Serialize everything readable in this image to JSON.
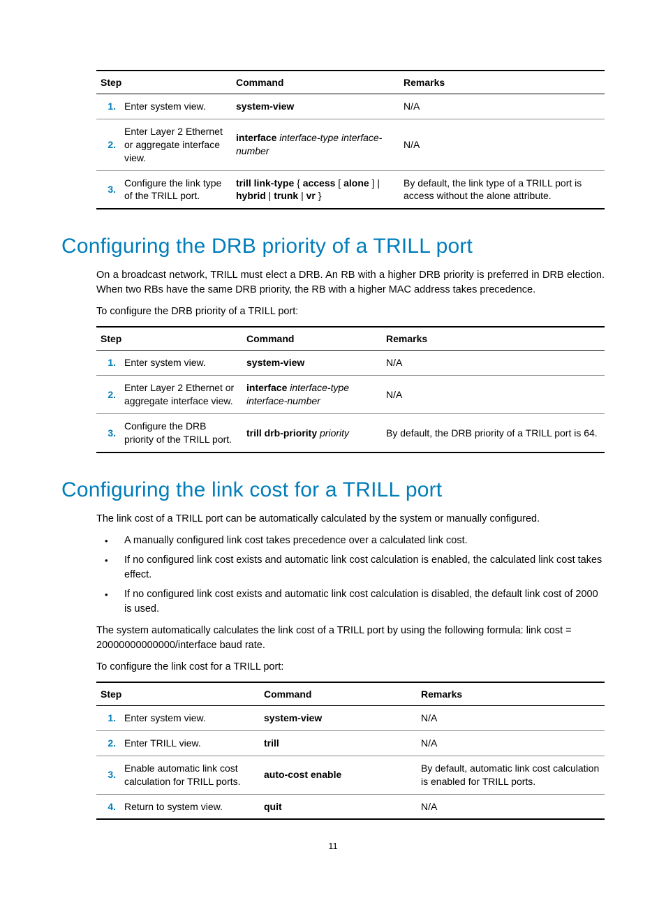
{
  "page_number": "11",
  "table1": {
    "headers": {
      "step": "Step",
      "command": "Command",
      "remarks": "Remarks"
    },
    "rows": [
      {
        "n": "1.",
        "step": "Enter system view.",
        "cmd_b": "system-view",
        "cmd_i": "",
        "remarks": "N/A"
      },
      {
        "n": "2.",
        "step": "Enter Layer 2 Ethernet or aggregate interface view.",
        "cmd_b": "interface",
        "cmd_i": "interface-type interface-number",
        "remarks": "N/A"
      },
      {
        "n": "3.",
        "step": "Configure the link type of the TRILL port.",
        "cmd_html": "<span class=\"b\">trill link-type</span> { <span class=\"b\">access</span> [ <span class=\"b\">alone</span> ] | <span class=\"b\">hybrid</span> | <span class=\"b\">trunk</span> | <span class=\"b\">vr</span> }",
        "remarks": "By default, the link type of a TRILL port is access without the alone attribute."
      }
    ]
  },
  "section1": {
    "title": "Configuring the DRB priority of a TRILL port",
    "para1": "On a broadcast network, TRILL must elect a DRB. An RB with a higher DRB priority is preferred in DRB election. When two RBs have the same DRB priority, the RB with a higher MAC address takes precedence.",
    "para2": "To configure the DRB priority of a TRILL port:"
  },
  "table2": {
    "headers": {
      "step": "Step",
      "command": "Command",
      "remarks": "Remarks"
    },
    "rows": [
      {
        "n": "1.",
        "step": "Enter system view.",
        "cmd_b": "system-view",
        "cmd_i": "",
        "remarks": "N/A"
      },
      {
        "n": "2.",
        "step": "Enter Layer 2 Ethernet or aggregate interface view.",
        "cmd_b": "interface",
        "cmd_i": "interface-type interface-number",
        "remarks": "N/A"
      },
      {
        "n": "3.",
        "step": "Configure the DRB priority of the TRILL port.",
        "cmd_b": "trill drb-priority",
        "cmd_i": "priority",
        "remarks": "By default, the DRB priority of a TRILL port is 64."
      }
    ]
  },
  "section2": {
    "title": "Configuring the link cost for a TRILL port",
    "para1": "The link cost of a TRILL port can be automatically calculated by the system or manually configured.",
    "bullets": [
      "A manually configured link cost takes precedence over a calculated link cost.",
      "If no configured link cost exists and automatic link cost calculation is enabled, the calculated link cost takes effect.",
      "If no configured link cost exists and automatic link cost calculation is disabled, the default link cost of 2000 is used."
    ],
    "para2": "The system automatically calculates the link cost of a TRILL port by using the following formula: link cost = 20000000000000/interface baud rate.",
    "para3": "To configure the link cost for a TRILL port:"
  },
  "table3": {
    "headers": {
      "step": "Step",
      "command": "Command",
      "remarks": "Remarks"
    },
    "rows": [
      {
        "n": "1.",
        "step": "Enter system view.",
        "cmd_b": "system-view",
        "cmd_i": "",
        "remarks": "N/A"
      },
      {
        "n": "2.",
        "step": "Enter TRILL view.",
        "cmd_b": "trill",
        "cmd_i": "",
        "remarks": "N/A"
      },
      {
        "n": "3.",
        "step": "Enable automatic link cost calculation for TRILL ports.",
        "cmd_b": "auto-cost enable",
        "cmd_i": "",
        "remarks": "By default, automatic link cost calculation is enabled for TRILL ports."
      },
      {
        "n": "4.",
        "step": "Return to system view.",
        "cmd_b": "quit",
        "cmd_i": "",
        "remarks": "N/A"
      }
    ]
  }
}
